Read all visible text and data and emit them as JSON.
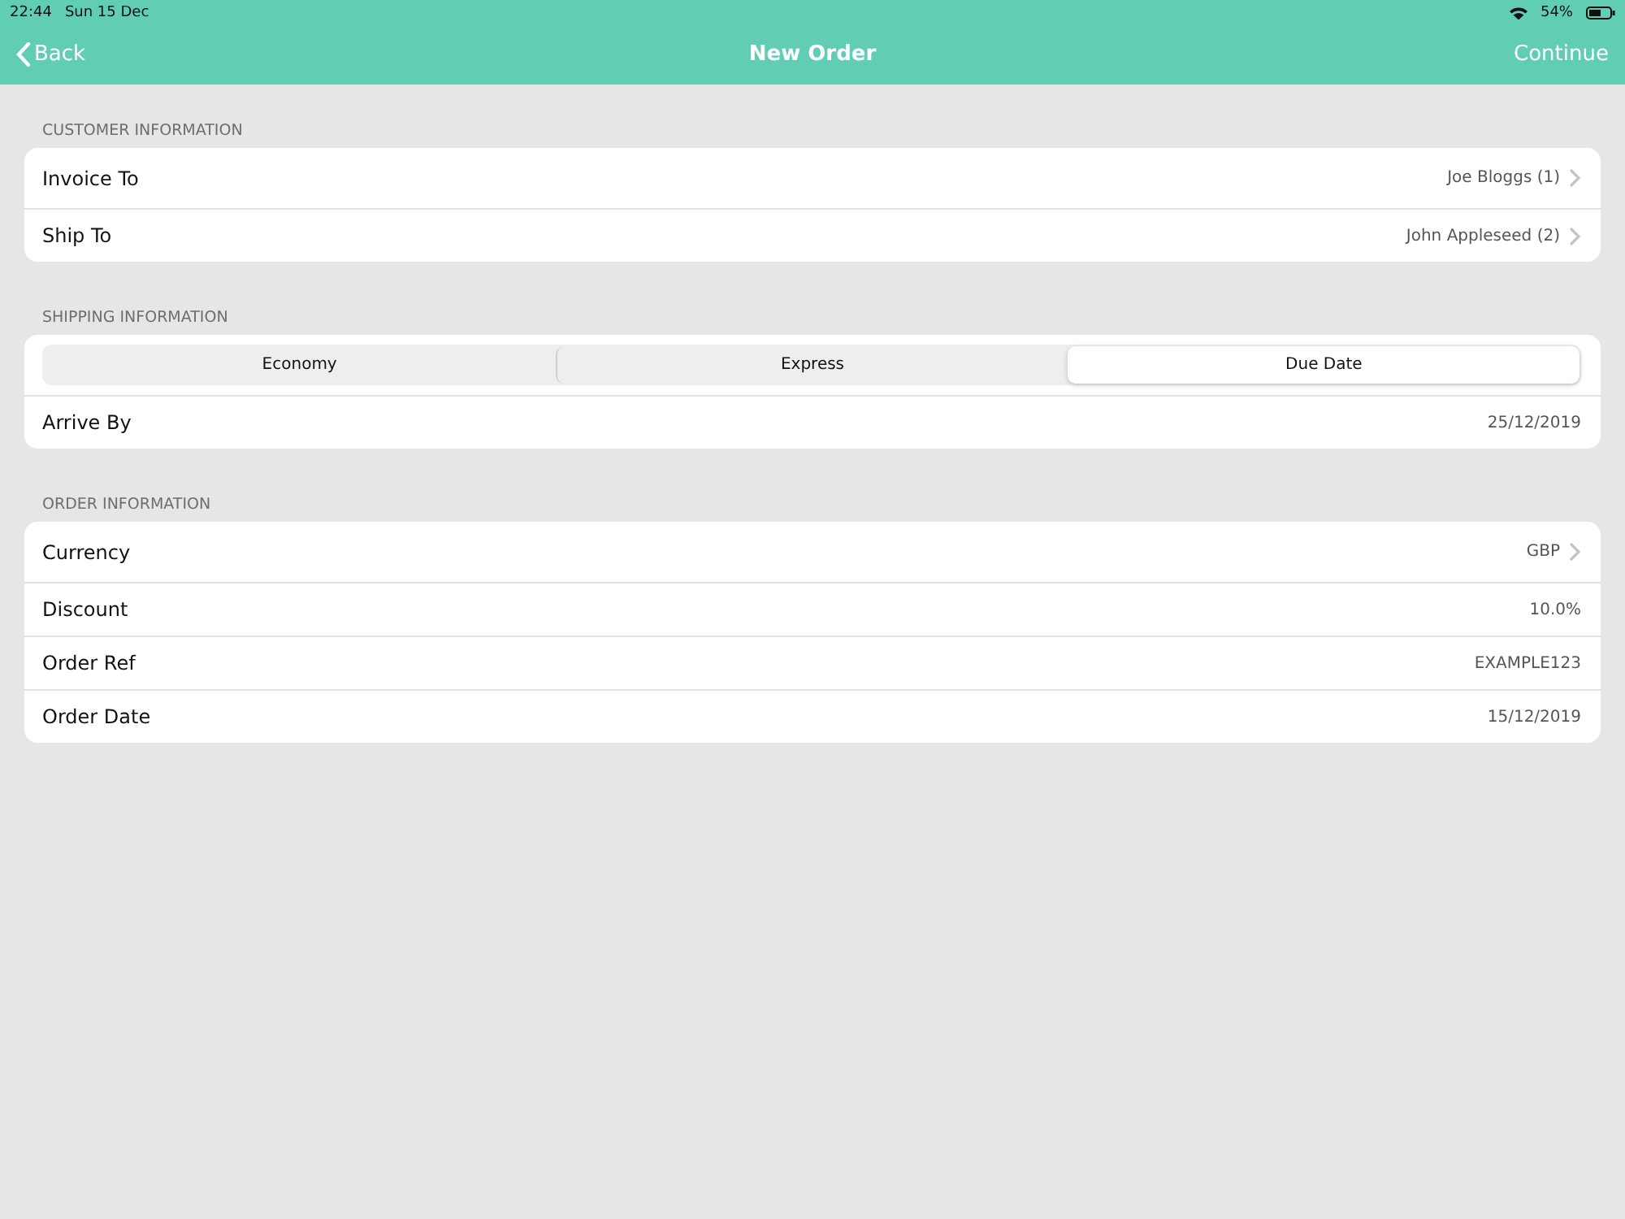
{
  "status_bar": {
    "time": "22:44",
    "date": "Sun 15 Dec",
    "battery": "54%"
  },
  "nav": {
    "back": "Back",
    "title": "New Order",
    "action": "Continue"
  },
  "sections": [
    {
      "header": "CUSTOMER INFORMATION",
      "items": [
        {
          "kind": "row",
          "label": "Invoice To",
          "value": "Joe Bloggs (1)",
          "disclosure": true
        },
        {
          "kind": "row",
          "label": "Ship To",
          "value": "John Appleseed (2)",
          "disclosure": true
        }
      ]
    },
    {
      "header": "SHIPPING INFORMATION",
      "items": [
        {
          "kind": "segmented",
          "segments": [
            {
              "label": "Economy",
              "selected": false
            },
            {
              "label": "Express",
              "selected": false
            },
            {
              "label": "Due Date",
              "selected": true
            }
          ]
        },
        {
          "kind": "row",
          "label": "Arrive By",
          "value": "25/12/2019",
          "disclosure": false
        }
      ]
    },
    {
      "header": "ORDER INFORMATION",
      "items": [
        {
          "kind": "row",
          "label": "Currency",
          "value": "GBP",
          "disclosure": true
        },
        {
          "kind": "row",
          "label": "Discount",
          "value": "10.0%",
          "disclosure": false
        },
        {
          "kind": "row",
          "label": "Order Ref",
          "value": "EXAMPLE123",
          "disclosure": false
        },
        {
          "kind": "row",
          "label": "Order Date",
          "value": "15/12/2019",
          "disclosure": false
        }
      ]
    }
  ]
}
